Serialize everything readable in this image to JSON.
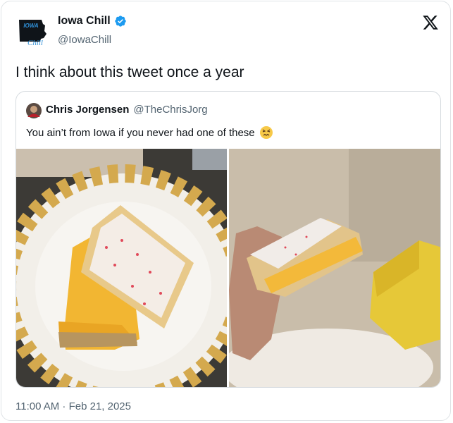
{
  "author": {
    "display_name": "Iowa Chill",
    "handle": "@IowaChill",
    "avatar_text": "IOWA CHILL"
  },
  "tweet": {
    "text": "I think about this tweet once a year",
    "timestamp": "11:00 AM · Feb 21, 2025"
  },
  "quoted_tweet": {
    "display_name": "Chris Jorgensen",
    "handle": "@TheChrisJorg",
    "text": "You ain’t from Iowa if you never had one of these",
    "emoji": "confounded-face-emoji"
  },
  "colors": {
    "verified": "#1d9bf0",
    "text": "#0f1419",
    "secondary": "#536471",
    "border": "#dfe3e6"
  },
  "icons": [
    "x-logo-icon",
    "verified-badge-icon"
  ]
}
